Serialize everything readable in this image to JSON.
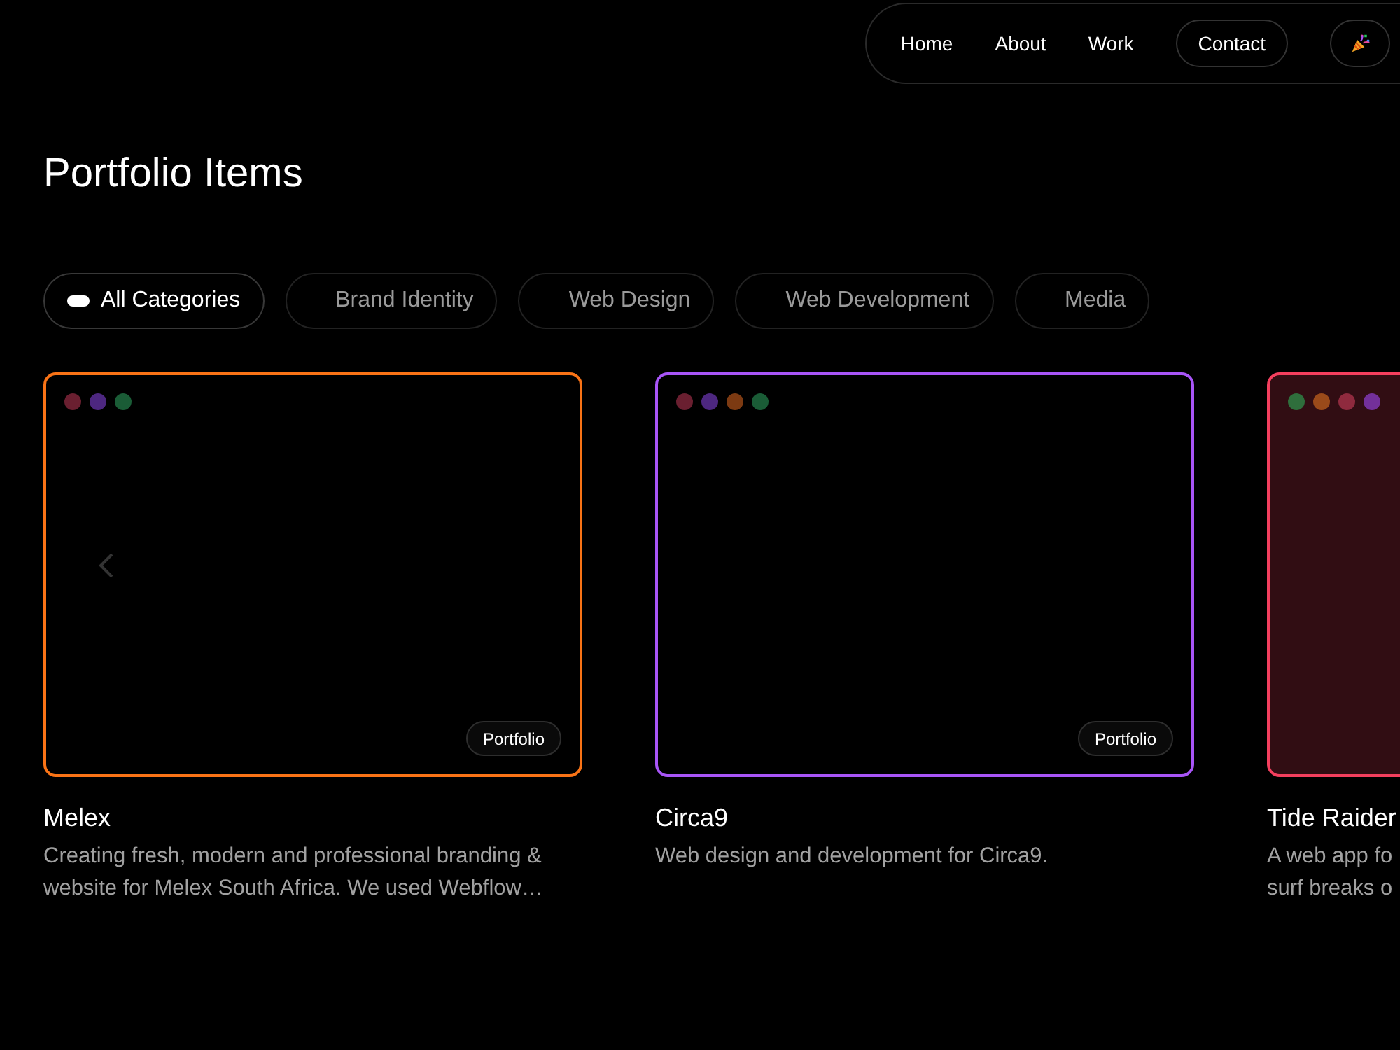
{
  "nav": {
    "items": [
      {
        "label": "Home",
        "kind": "link"
      },
      {
        "label": "About",
        "kind": "link"
      },
      {
        "label": "Work",
        "kind": "link"
      },
      {
        "label": "Contact",
        "kind": "button"
      }
    ]
  },
  "page_title": "Portfolio Items",
  "filters": [
    {
      "label": "All Categories",
      "selected": true
    },
    {
      "label": "Brand Identity",
      "selected": false
    },
    {
      "label": "Web Design",
      "selected": false
    },
    {
      "label": "Web Development",
      "selected": false
    },
    {
      "label": "Media",
      "selected": false
    }
  ],
  "projects": [
    {
      "title": "Melex",
      "description_lines": [
        "Creating fresh, modern and professional branding &",
        "website for Melex South Africa. We used Webflow…"
      ],
      "color": "#f97316",
      "highlighted": false,
      "carousel_arrow": true,
      "badge": "Portfolio",
      "dots": [
        {
          "color": "#6a1f30"
        },
        {
          "color": "#4d2780"
        },
        {
          "color": "#1a5c36"
        }
      ]
    },
    {
      "title": "Circa9",
      "description_lines": [
        "Web design and development for Circa9."
      ],
      "color": "#a855f7",
      "highlighted": false,
      "carousel_arrow": false,
      "badge": "Portfolio",
      "dots": [
        {
          "color": "#6a1f30"
        },
        {
          "color": "#4d2780"
        },
        {
          "color": "#7c3a12"
        },
        {
          "color": "#1a5c36"
        }
      ]
    },
    {
      "title": "Tide Raider",
      "description_lines": [
        "A web app fo",
        "surf breaks o"
      ],
      "color": "#f43f5e",
      "highlighted": true,
      "carousel_arrow": false,
      "dots": [
        {
          "color": "#2f6e3c"
        },
        {
          "color": "#9a4a1a"
        },
        {
          "color": "#8f2a3e"
        },
        {
          "color": "#73309a"
        }
      ]
    }
  ]
}
